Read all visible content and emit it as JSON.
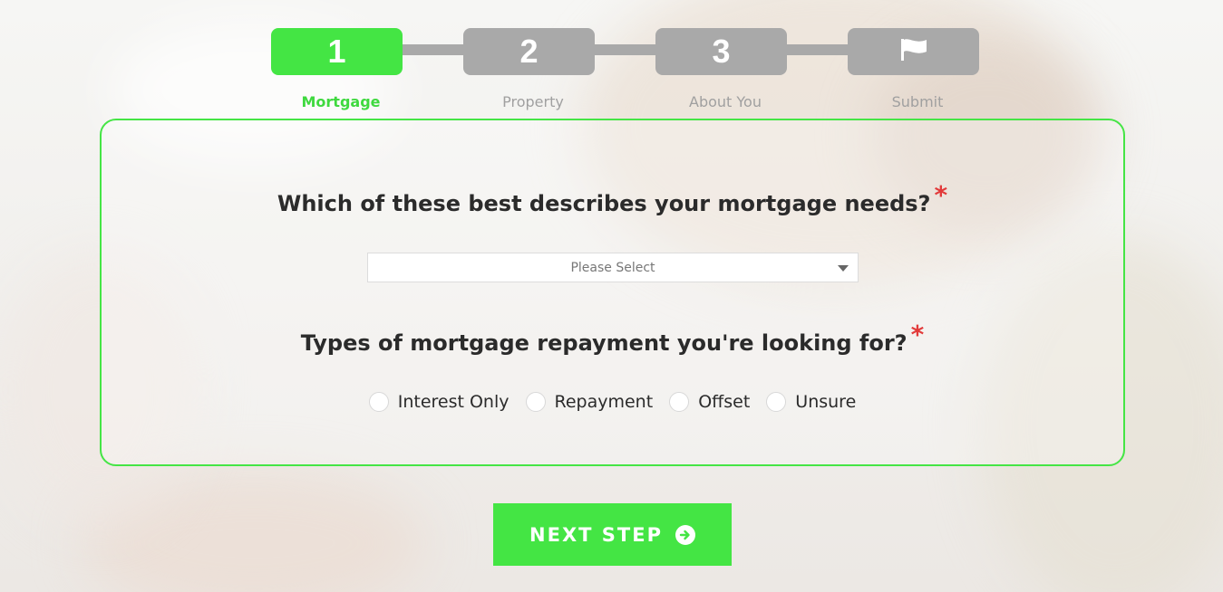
{
  "stepper": {
    "steps": [
      {
        "number": "1",
        "label": "Mortgage",
        "active": true
      },
      {
        "number": "2",
        "label": "Property",
        "active": false
      },
      {
        "number": "3",
        "label": "About You",
        "active": false
      },
      {
        "number": "flag-icon",
        "label": "Submit",
        "active": false
      }
    ]
  },
  "form": {
    "q1": {
      "text": "Which of these best describes your mortgage needs?",
      "required_mark": "*"
    },
    "select": {
      "value": "Please Select"
    },
    "q2": {
      "text": "Types of mortgage repayment you're looking for?",
      "required_mark": "*"
    },
    "radio_options": [
      "Interest Only",
      "Repayment",
      "Offset",
      "Unsure"
    ]
  },
  "next_button": {
    "label": "NEXT STEP",
    "icon": "arrow-right-circle-icon"
  },
  "colors": {
    "accent": "#44e544",
    "inactive": "#a9a9a9",
    "required": "#e23a3a"
  }
}
